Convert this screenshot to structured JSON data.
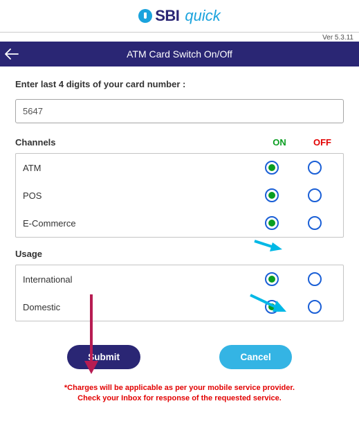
{
  "logo": {
    "brand": "SBI",
    "sub": "quick"
  },
  "version": "Ver 5.3.11",
  "titlebar": "ATM Card Switch On/Off",
  "form": {
    "card_label": "Enter last 4 digits of your card number :",
    "card_value": "5647",
    "channels_header": "Channels",
    "on_header": "ON",
    "off_header": "OFF",
    "channels": [
      {
        "label": "ATM",
        "on": true
      },
      {
        "label": "POS",
        "on": true
      },
      {
        "label": "E-Commerce",
        "on": true
      }
    ],
    "usage_header": "Usage",
    "usage": [
      {
        "label": "International",
        "on": true
      },
      {
        "label": "Domestic",
        "on": true
      }
    ]
  },
  "buttons": {
    "submit": "Submit",
    "cancel": "Cancel"
  },
  "disclaimer": {
    "line1": "*Charges will be applicable as per your mobile service provider.",
    "line2": "Check your Inbox for response of the requested service."
  }
}
